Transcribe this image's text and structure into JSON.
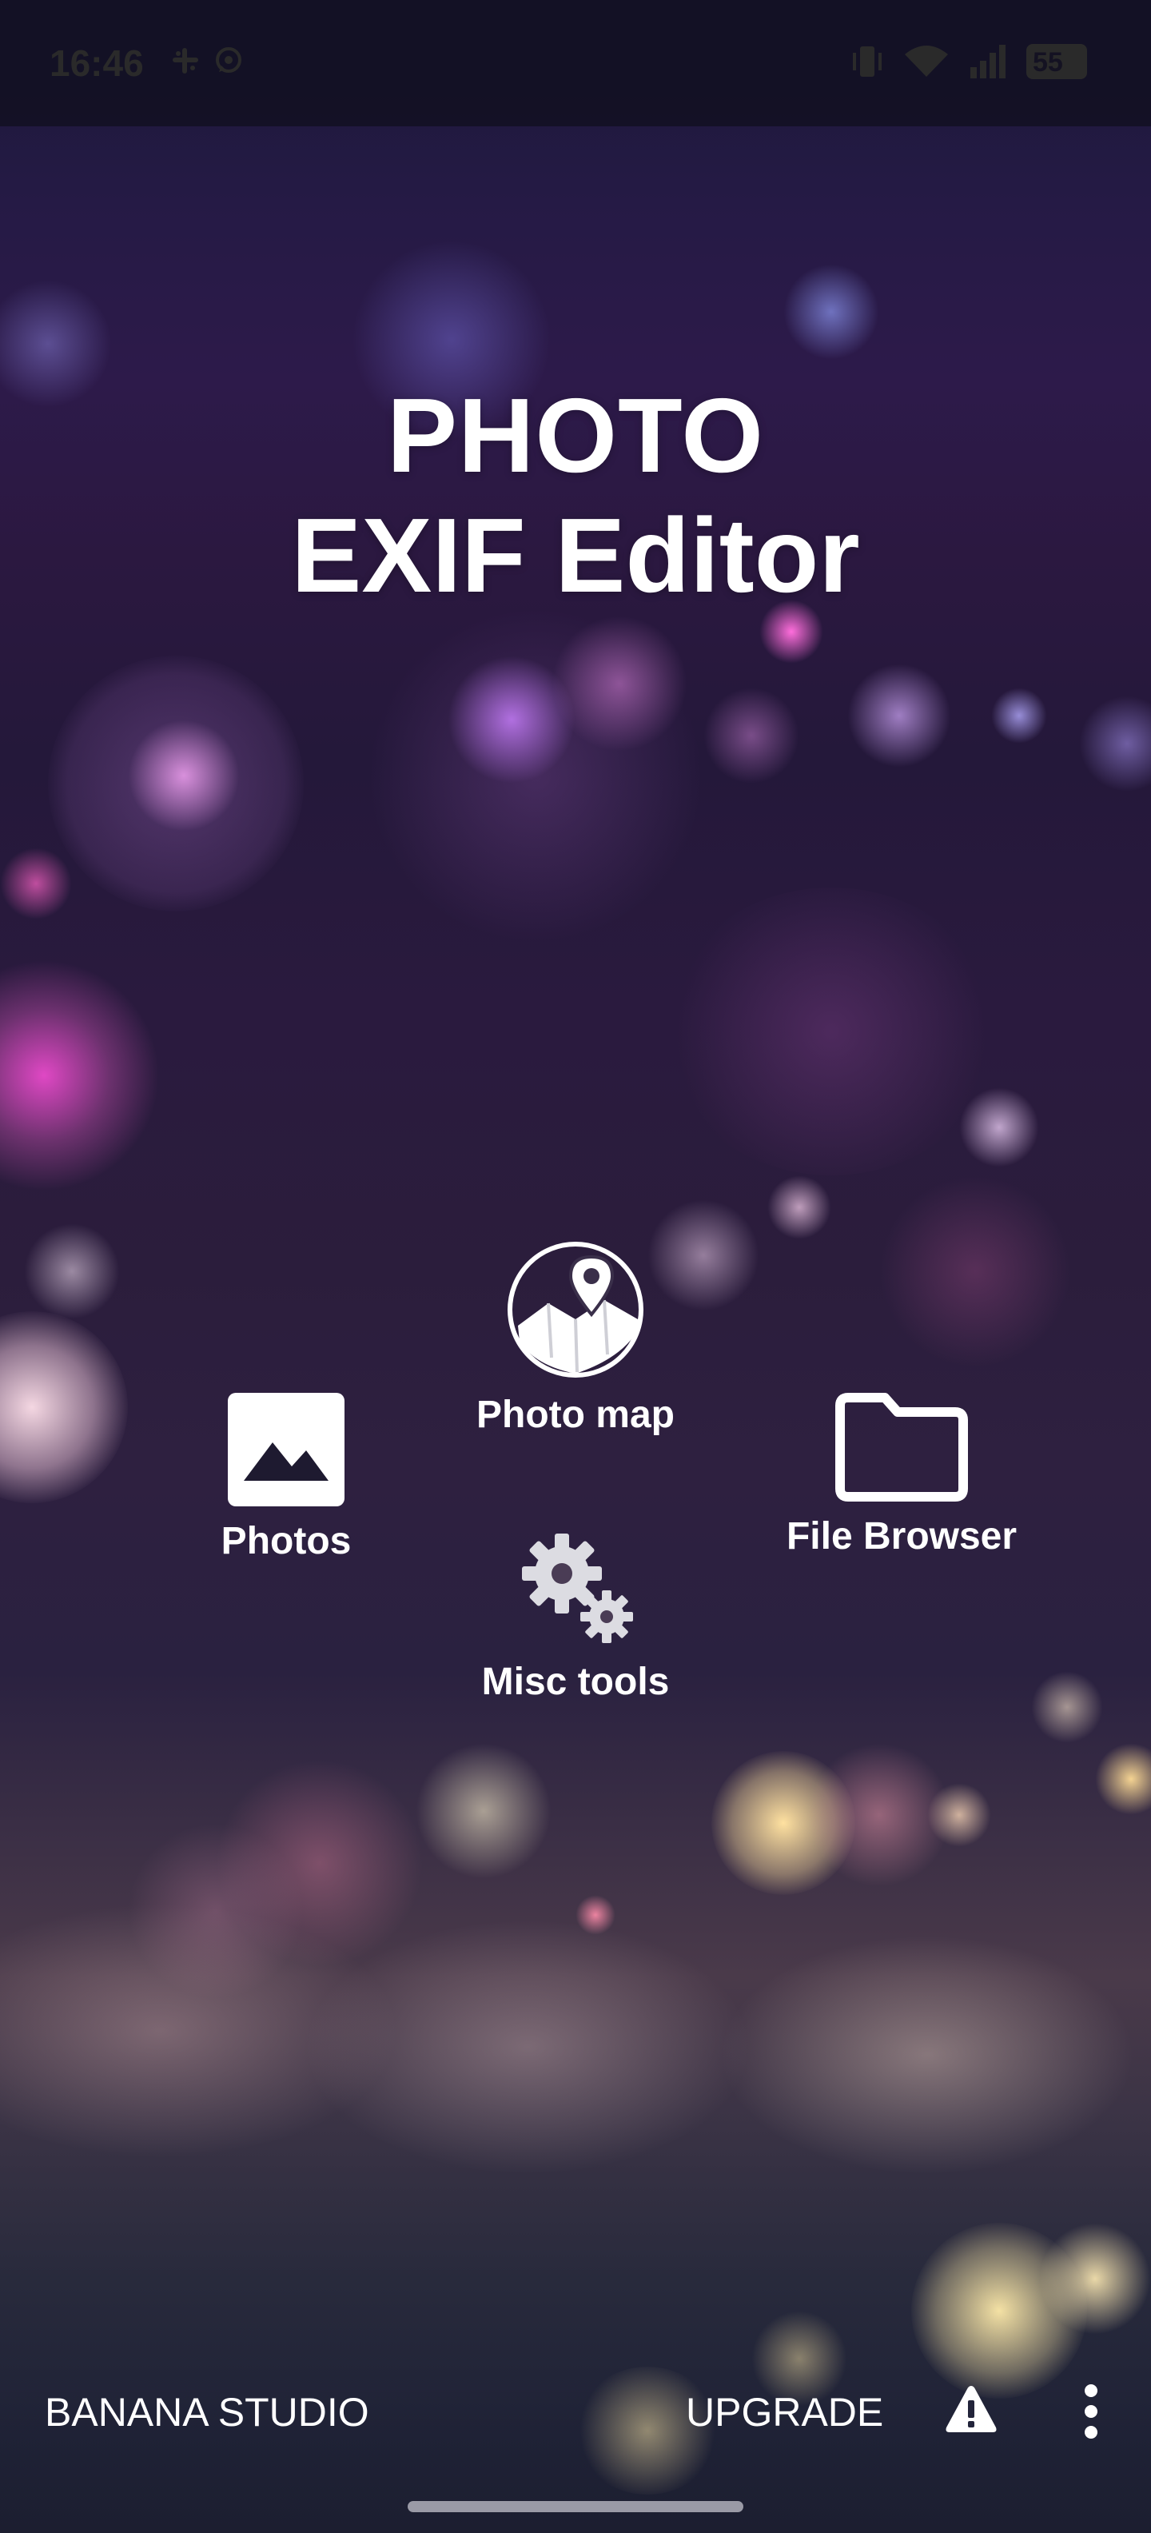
{
  "status_bar": {
    "time": "16:46",
    "left_icons": [
      "slack-icon",
      "whatsapp-icon"
    ],
    "right_icons": [
      "vibrate-icon",
      "wifi-icon",
      "signal-icon",
      "battery-icon"
    ],
    "battery_level": "55"
  },
  "title": {
    "line1": "PHOTO",
    "line2": "EXIF Editor"
  },
  "menu": {
    "photo_map": {
      "label": "Photo map",
      "icon": "map-pin-icon"
    },
    "photos": {
      "label": "Photos",
      "icon": "image-icon"
    },
    "file_browser": {
      "label": "File Browser",
      "icon": "folder-icon"
    },
    "misc_tools": {
      "label": "Misc tools",
      "icon": "gears-icon"
    }
  },
  "bottom_bar": {
    "brand": "BANANA STUDIO",
    "upgrade": "UPGRADE",
    "warning_icon": "warning-icon",
    "more_icon": "more-vertical-icon"
  },
  "colors": {
    "text": "#ffffff",
    "bg_top": "#1a1838",
    "bg_mid": "#2b1840",
    "bg_bottom": "#1c1e30"
  }
}
